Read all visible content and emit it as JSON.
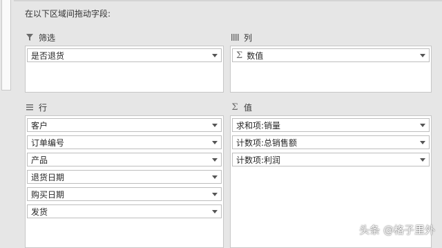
{
  "instruction": "在以下区域间拖动字段:",
  "filters": {
    "title": "筛选",
    "icon": "filter-icon",
    "items": [
      {
        "label": "是否退货"
      }
    ]
  },
  "columns": {
    "title": "列",
    "icon": "columns-icon",
    "items": [
      {
        "label": "数值",
        "icon": "sigma-icon"
      }
    ]
  },
  "rows": {
    "title": "行",
    "icon": "rows-icon",
    "items": [
      {
        "label": "客户"
      },
      {
        "label": "订单编号"
      },
      {
        "label": "产品"
      },
      {
        "label": "退货日期"
      },
      {
        "label": "购买日期"
      },
      {
        "label": "发货"
      }
    ]
  },
  "values": {
    "title": "值",
    "icon": "sigma-icon",
    "items": [
      {
        "label": "求和项:销量"
      },
      {
        "label": "计数项:总销售额"
      },
      {
        "label": "计数项:利润"
      }
    ]
  },
  "watermark": "头条 @格子里外"
}
